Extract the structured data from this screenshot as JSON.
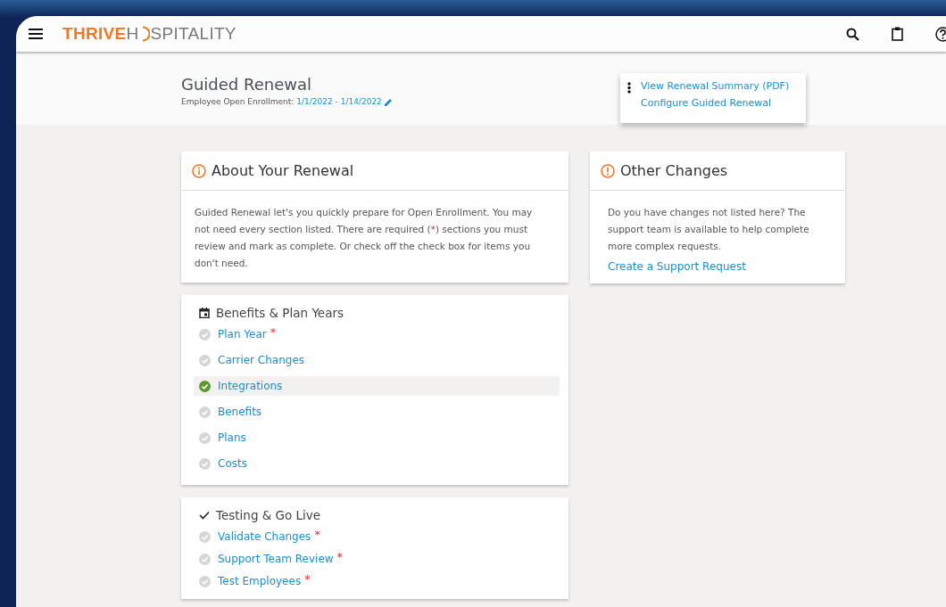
{
  "brand": {
    "first": "THRIVE",
    "second_before": "H",
    "second_after": "SPITALITY"
  },
  "header": {
    "title": "Guided Renewal",
    "subtitle_label": "Employee Open Enrollment:",
    "date_range": "1/1/2022 - 1/14/2022"
  },
  "menu": {
    "items": [
      {
        "label": "View Renewal Summary (PDF)"
      },
      {
        "label": "Configure Guided Renewal"
      }
    ]
  },
  "about": {
    "title": "About Your Renewal",
    "body_before": "Guided Renewal let's you quickly prepare for Open Enrollment. You may not need every section listed. There are required (",
    "body_mark": "*",
    "body_after": ") sections you must review and mark as complete. Or check off the check box for items you don't need."
  },
  "other": {
    "title": "Other Changes",
    "body": "Do you have changes not listed here? The support team is available to help complete more complex requests.",
    "link": "Create a Support Request"
  },
  "sections": [
    {
      "kind": "calendar",
      "title": "Benefits & Plan Years",
      "items": [
        {
          "label": "Plan Year",
          "required": true,
          "completed": false,
          "selected": false
        },
        {
          "label": "Carrier Changes",
          "required": false,
          "completed": false,
          "selected": false
        },
        {
          "label": "Integrations",
          "required": false,
          "completed": true,
          "selected": true
        },
        {
          "label": "Benefits",
          "required": false,
          "completed": false,
          "selected": false
        },
        {
          "label": "Plans",
          "required": false,
          "completed": false,
          "selected": false
        },
        {
          "label": "Costs",
          "required": false,
          "completed": false,
          "selected": false
        }
      ]
    },
    {
      "kind": "check",
      "title": "Testing & Go Live",
      "items": [
        {
          "label": "Validate Changes",
          "required": true,
          "completed": false,
          "selected": false
        },
        {
          "label": "Support Team Review",
          "required": true,
          "completed": false,
          "selected": false
        },
        {
          "label": "Test Employees",
          "required": true,
          "completed": false,
          "selected": false
        }
      ]
    }
  ]
}
